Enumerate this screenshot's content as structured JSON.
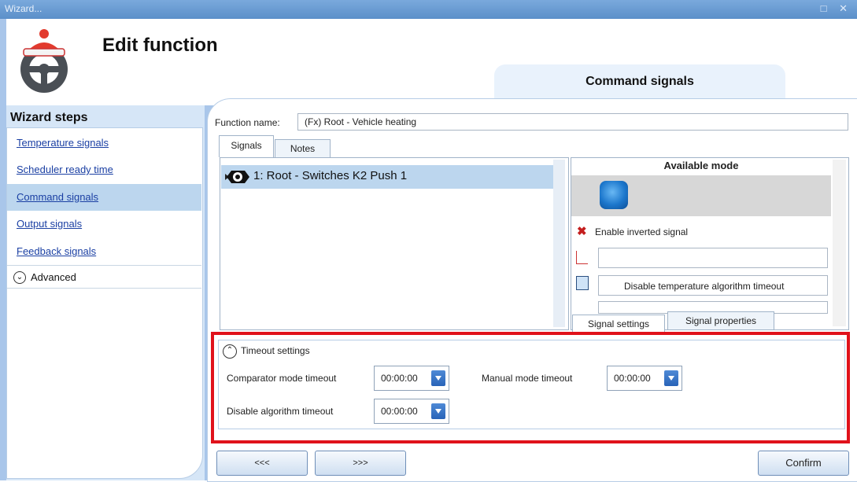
{
  "window": {
    "title": "Wizard...",
    "controls": "□ ✕"
  },
  "header": {
    "title": "Edit function",
    "current_step": "Command signals"
  },
  "sidebar": {
    "title": "Wizard steps",
    "items": [
      {
        "label": "Temperature signals"
      },
      {
        "label": "Scheduler ready time"
      },
      {
        "label": "Command signals",
        "active": true
      },
      {
        "label": "Output signals"
      },
      {
        "label": "Feedback signals"
      }
    ],
    "advanced_label": "Advanced"
  },
  "function": {
    "label": "Function name:",
    "value": "(Fx) Root - Vehicle heating"
  },
  "tabs": {
    "signals": "Signals",
    "notes": "Notes"
  },
  "signals_list": [
    {
      "label": "1: Root - Switches K2 Push 1"
    }
  ],
  "right_panel": {
    "title": "Available mode",
    "inverted_label": "Enable inverted signal",
    "combo1_value": "",
    "combo2_value": "Disable temperature algorithm timeout",
    "tab_settings": "Signal settings",
    "tab_properties": "Signal properties"
  },
  "timeout": {
    "title": "Timeout settings",
    "comparator_label": "Comparator mode timeout",
    "comparator_value": "00:00:00",
    "manual_label": "Manual mode timeout",
    "manual_value": "00:00:00",
    "disable_label": "Disable algorithm timeout",
    "disable_value": "00:00:00"
  },
  "buttons": {
    "prev": "<<<",
    "next": ">>>",
    "confirm": "Confirm"
  },
  "colors": {
    "accent": "#5b8fc9",
    "highlight": "#e0121b",
    "selection": "#bcd6ee"
  }
}
